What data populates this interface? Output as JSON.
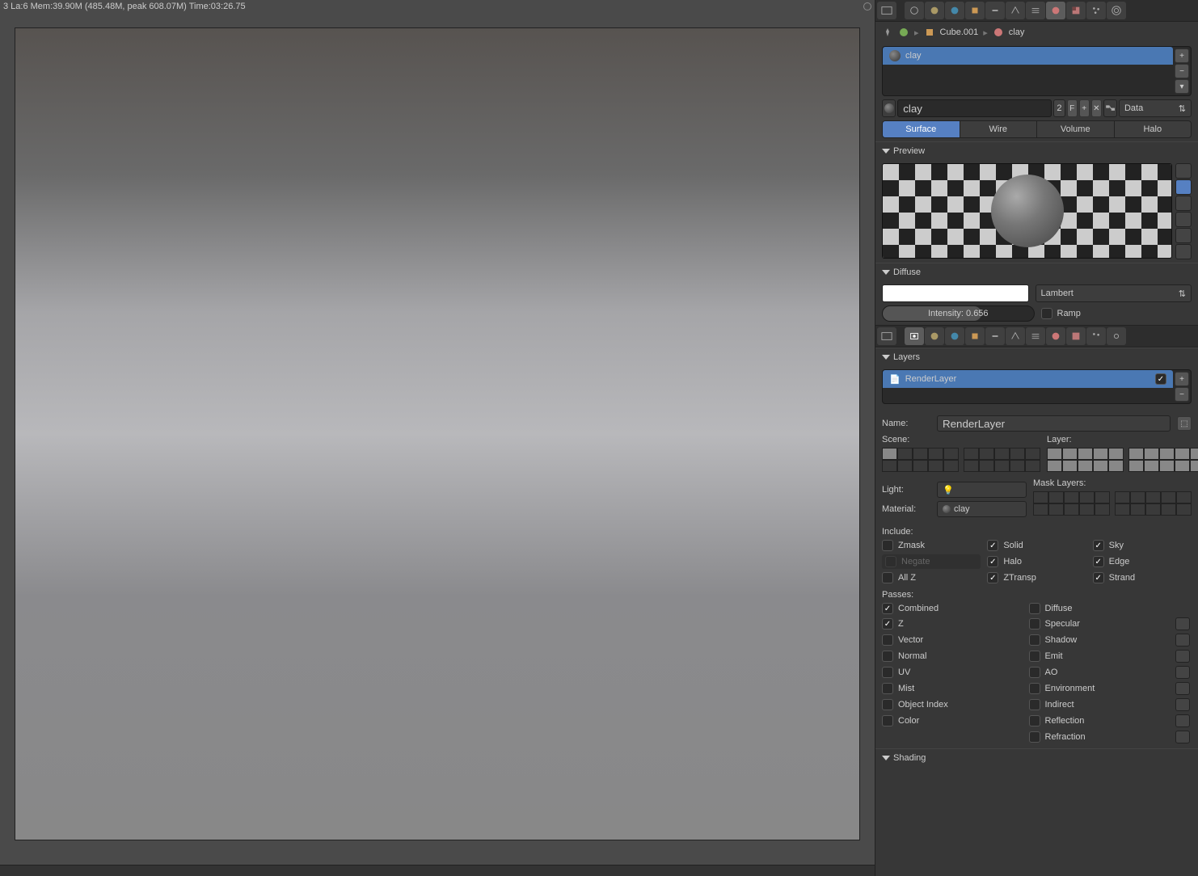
{
  "status_bar": "3 La:6 Mem:39.90M (485.48M, peak 608.07M) Time:03:26.75",
  "breadcrumb": {
    "object": "Cube.001",
    "material": "clay"
  },
  "material": {
    "slot_name": "clay",
    "name_field": "clay",
    "users": "2",
    "fake": "F",
    "link_mode": "Data"
  },
  "shade_modes": {
    "surface": "Surface",
    "wire": "Wire",
    "volume": "Volume",
    "halo": "Halo"
  },
  "panels": {
    "preview": "Preview",
    "diffuse": "Diffuse",
    "layers": "Layers",
    "shading": "Shading"
  },
  "diffuse": {
    "model": "Lambert",
    "intensity_label": "Intensity: 0.656",
    "ramp": "Ramp"
  },
  "render_layer": {
    "list_name": "RenderLayer",
    "name_label": "Name:",
    "name_value": "RenderLayer",
    "scene_label": "Scene:",
    "layer_label": "Layer:",
    "mask_label": "Mask Layers:",
    "light_label": "Light:",
    "light_value": "",
    "material_label": "Material:",
    "material_value": "clay"
  },
  "include": {
    "title": "Include:",
    "zmask": "Zmask",
    "negate": "Negate",
    "allz": "All Z",
    "solid": "Solid",
    "halo": "Halo",
    "ztransp": "ZTransp",
    "sky": "Sky",
    "edge": "Edge",
    "strand": "Strand"
  },
  "passes": {
    "title": "Passes:",
    "combined": "Combined",
    "z": "Z",
    "vector": "Vector",
    "normal": "Normal",
    "uv": "UV",
    "mist": "Mist",
    "object_index": "Object Index",
    "color": "Color",
    "diffuse": "Diffuse",
    "specular": "Specular",
    "shadow": "Shadow",
    "emit": "Emit",
    "ao": "AO",
    "environment": "Environment",
    "indirect": "Indirect",
    "reflection": "Reflection",
    "refraction": "Refraction"
  }
}
